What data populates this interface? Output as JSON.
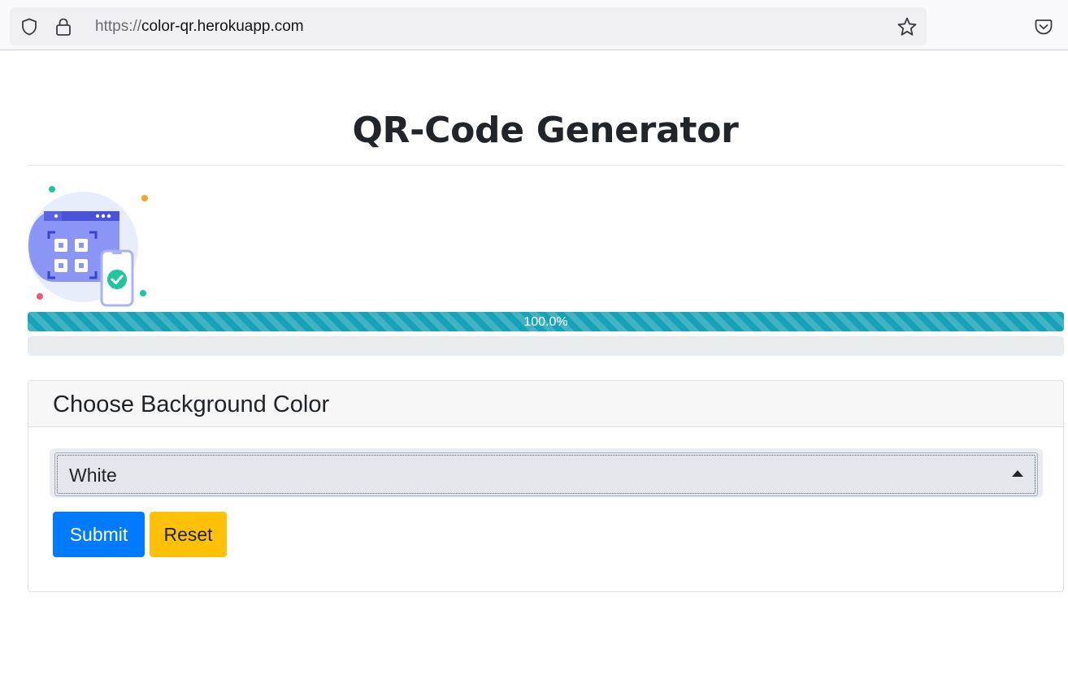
{
  "browser": {
    "url_scheme": "https://",
    "url_host": "color-qr.herokuapp.com",
    "icons": [
      "shield-icon",
      "lock-icon",
      "star-icon",
      "pocket-icon"
    ]
  },
  "page": {
    "title": "QR-Code Generator",
    "progress": {
      "percent": 100,
      "label": "100.0%"
    },
    "colors": {
      "progress": "#17a2b8",
      "primary": "#007bff",
      "warning": "#ffc107"
    }
  },
  "form": {
    "card_title": "Choose Background Color",
    "select_value": "White",
    "submit_label": "Submit",
    "reset_label": "Reset"
  }
}
